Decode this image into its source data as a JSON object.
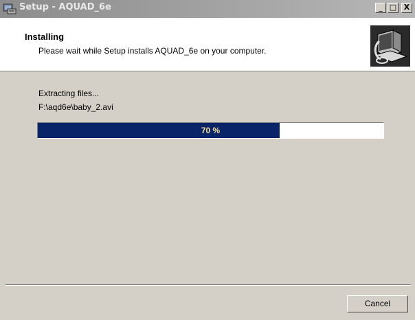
{
  "window": {
    "title": "Setup - AQUAD_6e",
    "minimize": "_",
    "maximize": "□",
    "close": "X"
  },
  "header": {
    "title": "Installing",
    "subtitle": "Please wait while Setup installs AQUAD_6e on your computer."
  },
  "main": {
    "status_text": "Extracting files...",
    "current_file": "F:\\aqd6e\\baby_2.avi",
    "progress_percent": 70,
    "progress_label": "70 %"
  },
  "footer": {
    "cancel_label": "Cancel"
  },
  "colors": {
    "progress_fill": "#0a246a",
    "face": "#d4d0c8"
  }
}
